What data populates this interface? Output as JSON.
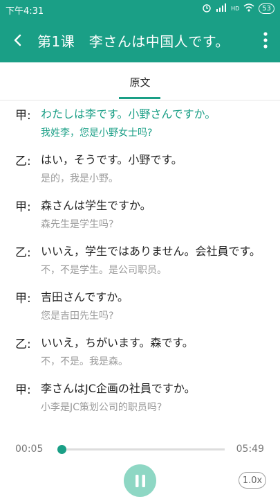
{
  "status_bar": {
    "time": "下午4:31",
    "signal_label": "HD",
    "battery": "53"
  },
  "app_bar": {
    "title": "第1课　李さんは中国人です。"
  },
  "tabs": [
    {
      "label": "原文",
      "active": true
    }
  ],
  "dialogue": [
    {
      "speaker": "甲:",
      "jp": "わたしは李です。小野さんですか。",
      "cn": "我姓李，您是小野女士吗?",
      "active": true
    },
    {
      "speaker": "乙:",
      "jp": "はい，そうです。小野です。",
      "cn": "是的，我是小野。",
      "active": false
    },
    {
      "speaker": "甲:",
      "jp": "森さんは学生ですか。",
      "cn": "森先生是学生吗?",
      "active": false
    },
    {
      "speaker": "乙:",
      "jp": "いいえ，学生ではありません。会社員です。",
      "cn": "不，不是学生。是公司职员。",
      "active": false
    },
    {
      "speaker": "甲:",
      "jp": "吉田さんですか。",
      "cn": "您是吉田先生吗?",
      "active": false
    },
    {
      "speaker": "乙:",
      "jp": "いいえ，ちがいます。森です。",
      "cn": "不，不是。我是森。",
      "active": false
    },
    {
      "speaker": "甲:",
      "jp": "李さんはJC企画の社員ですか。",
      "cn": "小李是JC策划公司的职员吗?",
      "active": false
    }
  ],
  "player": {
    "current_time": "00:05",
    "total_time": "05:49",
    "progress_fraction": 0.0,
    "speed": "1.0x",
    "state": "playing"
  },
  "colors": {
    "accent": "#1a9f86",
    "play_button": "#8ed7c4"
  }
}
